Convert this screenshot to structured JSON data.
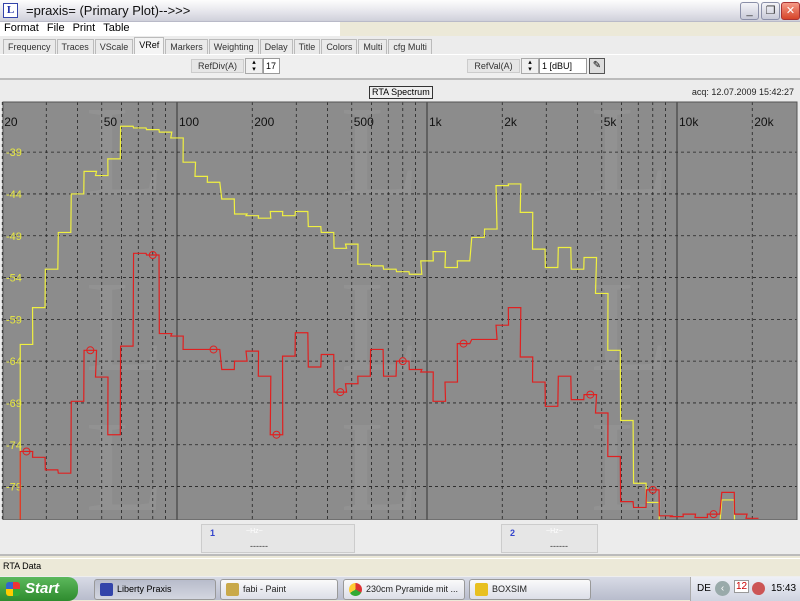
{
  "window": {
    "title": "=praxis= (Primary Plot)-->>>",
    "icon": "L",
    "min": "_",
    "max": "❐",
    "close": "✕"
  },
  "menu": [
    "Format",
    "File",
    "Print",
    "Table"
  ],
  "tabs": [
    "Frequency",
    "Traces",
    "VScale",
    "VRef",
    "Markers",
    "Weighting",
    "Delay",
    "Title",
    "Colors",
    "Multi",
    "cfg Multi"
  ],
  "active_tab": "VRef",
  "toolbar": {
    "refdiv_label": "RefDiv(A)",
    "refdiv_value": "17",
    "refval_label": "RefVal(A)",
    "refval_value": "1 [dBU]",
    "pen_icon": "✎"
  },
  "plot_header": {
    "title": "RTA Spectrum",
    "acq": "acq: 12.07.2009 15:42:27"
  },
  "markers": [
    {
      "num": "1",
      "unit": "~Hz~",
      "value": "------"
    },
    {
      "num": "2",
      "unit": "~Hz~",
      "value": "------"
    }
  ],
  "status": "RTA Data",
  "taskbar": {
    "start": "Start",
    "tasks": [
      "Liberty Praxis",
      "fabi - Paint",
      "230cm Pyramide mit ...",
      "BOXSIM"
    ],
    "lang": "DE",
    "clock": "15:43",
    "cal": "12"
  },
  "chart_data": {
    "type": "line",
    "step": true,
    "title": "RTA Spectrum",
    "xscale": "log",
    "xlim": [
      20,
      22000
    ],
    "ylim": [
      -83,
      -33
    ],
    "x_ticks": [
      {
        "v": 20,
        "l": "20"
      },
      {
        "v": 50,
        "l": "50"
      },
      {
        "v": 100,
        "l": "100"
      },
      {
        "v": 200,
        "l": "200"
      },
      {
        "v": 500,
        "l": "500"
      },
      {
        "v": 1000,
        "l": "1k"
      },
      {
        "v": 2000,
        "l": "2k"
      },
      {
        "v": 5000,
        "l": "5k"
      },
      {
        "v": 10000,
        "l": "10k"
      },
      {
        "v": 20000,
        "l": "20k"
      }
    ],
    "y_ticks": [
      -39,
      -44,
      -49,
      -54,
      -59,
      -64,
      -69,
      -74,
      -79
    ],
    "bands": [
      25,
      28,
      31.5,
      35.5,
      40,
      45,
      50,
      56,
      63,
      71,
      80,
      90,
      100,
      112,
      125,
      140,
      160,
      180,
      200,
      224,
      250,
      280,
      315,
      355,
      400,
      450,
      500,
      560,
      630,
      710,
      800,
      900,
      1000,
      1120,
      1250,
      1400,
      1600,
      1800,
      2000,
      2240,
      2500,
      2800,
      3150,
      3550,
      4000,
      4500,
      5000,
      5600,
      6300,
      7100,
      8000,
      9000,
      10000,
      11200,
      12500,
      14000,
      16000,
      18000,
      20000
    ],
    "series": [
      {
        "name": "trace-yellow",
        "color": "#f0f040",
        "values": [
          -62,
          -57.6,
          -53,
          -48.6,
          -44,
          -41.3,
          -41.8,
          -39.8,
          -35.9,
          -36.1,
          -36.3,
          -36.6,
          -37.3,
          -40.2,
          -41.9,
          -42.6,
          -44.6,
          -46.4,
          -46.6,
          -46.9,
          -46.1,
          -46.6,
          -46.1,
          -47.9,
          -48.6,
          -50.5,
          -50,
          -52.4,
          -52.6,
          -53,
          -53.3,
          -53.6,
          -52,
          -50.9,
          -52.8,
          -52,
          -49.2,
          -48.2,
          -43,
          -42.8,
          -46.2,
          -50.6,
          -52.8,
          -50.4,
          -53,
          -51.6,
          -55.9,
          -62.7,
          -71.1,
          -78.6,
          -80.9,
          -84,
          -84,
          -84,
          -84,
          -84,
          -80.6,
          -84,
          -84
        ],
        "markers": []
      },
      {
        "name": "trace-red",
        "color": "#e02020",
        "values": [
          -74.8,
          -75.5,
          -77,
          -77.4,
          -68.8,
          -62.7,
          -65.9,
          -72.8,
          -62.2,
          -51.1,
          -51.3,
          -60.7,
          -61,
          -62.6,
          -62.6,
          -62.6,
          -65,
          -64,
          -62.8,
          -65.8,
          -72.8,
          -63.4,
          -60.6,
          -64.7,
          -63.2,
          -67.7,
          -66.7,
          -65.8,
          -62.6,
          -65.8,
          -64,
          -65,
          -65.3,
          -68.8,
          -66.5,
          -61.9,
          -61.4,
          -61.4,
          -59.7,
          -57.6,
          -63.5,
          -66.5,
          -69.4,
          -65.8,
          -68.6,
          -68,
          -70.2,
          -75.4,
          -80.8,
          -81.5,
          -79.4,
          -82.5,
          -82.6,
          -82.3,
          -82.7,
          -82.3,
          -79.7,
          -82.3,
          -82.8
        ],
        "markers": [
          0,
          5,
          10,
          15,
          20,
          25,
          30,
          35,
          45,
          50,
          55
        ]
      }
    ]
  }
}
